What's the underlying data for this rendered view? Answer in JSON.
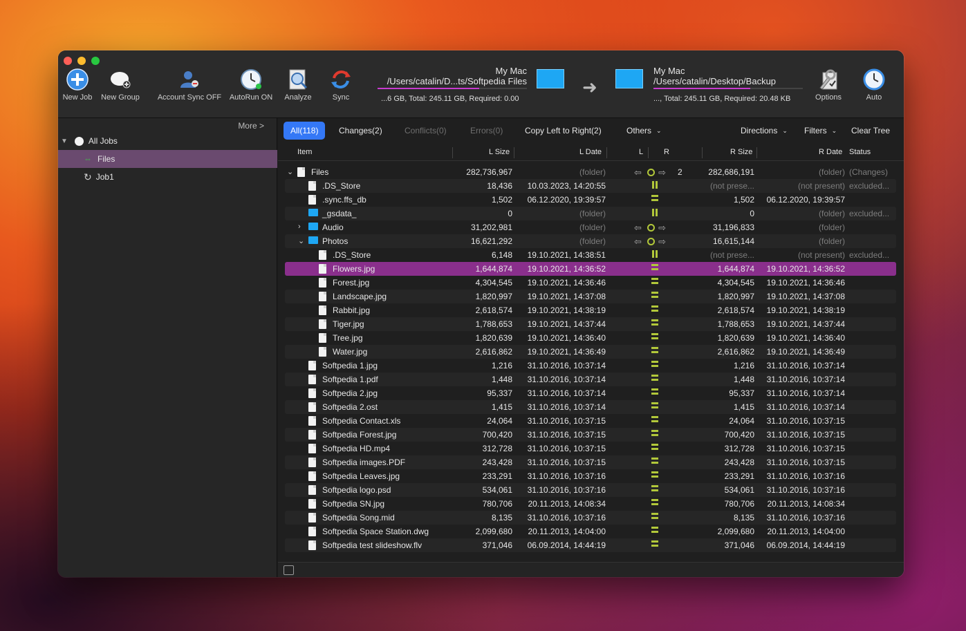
{
  "toolbar": {
    "new_job": "New Job",
    "new_group": "New Group",
    "account_sync": "Account Sync OFF",
    "autorun": "AutoRun ON",
    "analyze": "Analyze",
    "sync": "Sync",
    "options": "Options",
    "auto": "Auto"
  },
  "left_side": {
    "title": "My Mac",
    "path": "/Users/catalin/D...ts/Softpedia Files",
    "stats": "...6 GB, Total: 245.11 GB, Required: 0.00",
    "usage_fraction": 0.68
  },
  "right_side": {
    "title": "My Mac",
    "path": "/Users/catalin/Desktop/Backup",
    "stats": "..., Total: 245.11 GB, Required: 20.48 KB",
    "usage_fraction": 0.65
  },
  "sidebar": {
    "more": "More >",
    "all_jobs": "All Jobs",
    "items": [
      {
        "label": "Files"
      },
      {
        "label": "Job1"
      }
    ]
  },
  "filters": {
    "all": "All(118)",
    "changes": "Changes(2)",
    "conflicts": "Conflicts(0)",
    "errors": "Errors(0)",
    "copy": "Copy Left to Right(2)",
    "others": "Others",
    "directions": "Directions",
    "filters": "Filters",
    "clear": "Clear Tree"
  },
  "columns": {
    "item": "Item",
    "lsize": "L Size",
    "ldate": "L Date",
    "l": "L",
    "r": "R",
    "rsize": "R Size",
    "rdate": "R Date",
    "status": "Status"
  },
  "rows": [
    {
      "name": "Files",
      "lsize": "282,736,967",
      "ldate": "(folder)",
      "extra": "2",
      "rsize": "282,686,191",
      "rdate": "(folder)",
      "status": "(Changes)"
    },
    {
      "name": ".DS_Store",
      "lsize": "18,436",
      "ldate": "10.03.2023, 14:20:55",
      "rsize": "(not prese...",
      "rdate": "(not present)",
      "status": "excluded..."
    },
    {
      "name": ".sync.ffs_db",
      "lsize": "1,502",
      "ldate": "06.12.2020, 19:39:57",
      "rsize": "1,502",
      "rdate": "06.12.2020, 19:39:57",
      "status": ""
    },
    {
      "name": "_gsdata_",
      "lsize": "0",
      "ldate": "(folder)",
      "rsize": "0",
      "rdate": "(folder)",
      "status": "excluded..."
    },
    {
      "name": "Audio",
      "lsize": "31,202,981",
      "ldate": "(folder)",
      "rsize": "31,196,833",
      "rdate": "(folder)",
      "status": ""
    },
    {
      "name": "Photos",
      "lsize": "16,621,292",
      "ldate": "(folder)",
      "rsize": "16,615,144",
      "rdate": "(folder)",
      "status": ""
    },
    {
      "name": ".DS_Store",
      "lsize": "6,148",
      "ldate": "19.10.2021, 14:38:51",
      "rsize": "(not prese...",
      "rdate": "(not present)",
      "status": "excluded..."
    },
    {
      "name": "Flowers.jpg",
      "lsize": "1,644,874",
      "ldate": "19.10.2021, 14:36:52",
      "rsize": "1,644,874",
      "rdate": "19.10.2021, 14:36:52",
      "status": ""
    },
    {
      "name": "Forest.jpg",
      "lsize": "4,304,545",
      "ldate": "19.10.2021, 14:36:46",
      "rsize": "4,304,545",
      "rdate": "19.10.2021, 14:36:46",
      "status": ""
    },
    {
      "name": "Landscape.jpg",
      "lsize": "1,820,997",
      "ldate": "19.10.2021, 14:37:08",
      "rsize": "1,820,997",
      "rdate": "19.10.2021, 14:37:08",
      "status": ""
    },
    {
      "name": "Rabbit.jpg",
      "lsize": "2,618,574",
      "ldate": "19.10.2021, 14:38:19",
      "rsize": "2,618,574",
      "rdate": "19.10.2021, 14:38:19",
      "status": ""
    },
    {
      "name": "Tiger.jpg",
      "lsize": "1,788,653",
      "ldate": "19.10.2021, 14:37:44",
      "rsize": "1,788,653",
      "rdate": "19.10.2021, 14:37:44",
      "status": ""
    },
    {
      "name": "Tree.jpg",
      "lsize": "1,820,639",
      "ldate": "19.10.2021, 14:36:40",
      "rsize": "1,820,639",
      "rdate": "19.10.2021, 14:36:40",
      "status": ""
    },
    {
      "name": "Water.jpg",
      "lsize": "2,616,862",
      "ldate": "19.10.2021, 14:36:49",
      "rsize": "2,616,862",
      "rdate": "19.10.2021, 14:36:49",
      "status": ""
    },
    {
      "name": "Softpedia 1.jpg",
      "lsize": "1,216",
      "ldate": "31.10.2016, 10:37:14",
      "rsize": "1,216",
      "rdate": "31.10.2016, 10:37:14",
      "status": ""
    },
    {
      "name": "Softpedia 1.pdf",
      "lsize": "1,448",
      "ldate": "31.10.2016, 10:37:14",
      "rsize": "1,448",
      "rdate": "31.10.2016, 10:37:14",
      "status": ""
    },
    {
      "name": "Softpedia 2.jpg",
      "lsize": "95,337",
      "ldate": "31.10.2016, 10:37:14",
      "rsize": "95,337",
      "rdate": "31.10.2016, 10:37:14",
      "status": ""
    },
    {
      "name": "Softpedia 2.ost",
      "lsize": "1,415",
      "ldate": "31.10.2016, 10:37:14",
      "rsize": "1,415",
      "rdate": "31.10.2016, 10:37:14",
      "status": ""
    },
    {
      "name": "Softpedia Contact.xls",
      "lsize": "24,064",
      "ldate": "31.10.2016, 10:37:15",
      "rsize": "24,064",
      "rdate": "31.10.2016, 10:37:15",
      "status": ""
    },
    {
      "name": "Softpedia Forest.jpg",
      "lsize": "700,420",
      "ldate": "31.10.2016, 10:37:15",
      "rsize": "700,420",
      "rdate": "31.10.2016, 10:37:15",
      "status": ""
    },
    {
      "name": "Softpedia HD.mp4",
      "lsize": "312,728",
      "ldate": "31.10.2016, 10:37:15",
      "rsize": "312,728",
      "rdate": "31.10.2016, 10:37:15",
      "status": ""
    },
    {
      "name": "Softpedia images.PDF",
      "lsize": "243,428",
      "ldate": "31.10.2016, 10:37:15",
      "rsize": "243,428",
      "rdate": "31.10.2016, 10:37:15",
      "status": ""
    },
    {
      "name": "Softpedia Leaves.jpg",
      "lsize": "233,291",
      "ldate": "31.10.2016, 10:37:16",
      "rsize": "233,291",
      "rdate": "31.10.2016, 10:37:16",
      "status": ""
    },
    {
      "name": "Softpedia logo.psd",
      "lsize": "534,061",
      "ldate": "31.10.2016, 10:37:16",
      "rsize": "534,061",
      "rdate": "31.10.2016, 10:37:16",
      "status": ""
    },
    {
      "name": "Softpedia SN.jpg",
      "lsize": "780,706",
      "ldate": "20.11.2013, 14:08:34",
      "rsize": "780,706",
      "rdate": "20.11.2013, 14:08:34",
      "status": ""
    },
    {
      "name": "Softpedia Song.mid",
      "lsize": "8,135",
      "ldate": "31.10.2016, 10:37:16",
      "rsize": "8,135",
      "rdate": "31.10.2016, 10:37:16",
      "status": ""
    },
    {
      "name": "Softpedia Space Station.dwg",
      "lsize": "2,099,680",
      "ldate": "20.11.2013, 14:04:00",
      "rsize": "2,099,680",
      "rdate": "20.11.2013, 14:04:00",
      "status": ""
    },
    {
      "name": "Softpedia test slideshow.flv",
      "lsize": "371,046",
      "ldate": "06.09.2014, 14:44:19",
      "rsize": "371,046",
      "rdate": "06.09.2014, 14:44:19",
      "status": ""
    }
  ]
}
